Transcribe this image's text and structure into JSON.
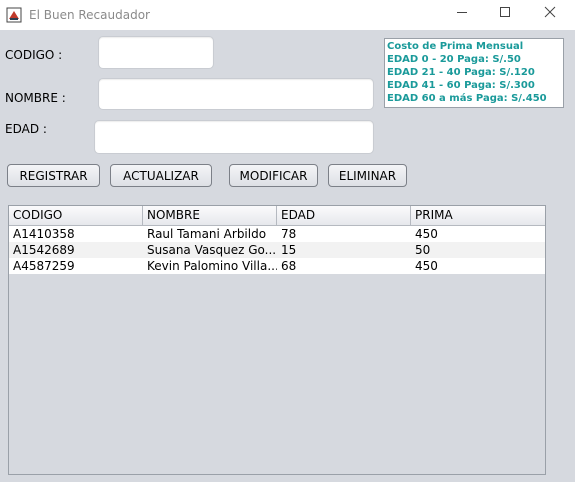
{
  "window": {
    "title": "El Buen Recaudador",
    "minimize_icon": "minimize-icon",
    "maximize_icon": "maximize-icon",
    "close_icon": "close-icon"
  },
  "form": {
    "codigo_label": "CODIGO :",
    "nombre_label": "NOMBRE :",
    "edad_label": "EDAD :",
    "codigo_value": "",
    "nombre_value": "",
    "edad_value": ""
  },
  "info_panel": {
    "lines": [
      "Costo de Prima Mensual",
      "EDAD 0 - 20 Paga: S/.50",
      "EDAD 21 - 40 Paga: S/.120",
      "EDAD 41 - 60 Paga: S/.300",
      "EDAD 60 a más Paga: S/.450"
    ],
    "text_color": "#1a9a9a"
  },
  "buttons": {
    "registrar": "REGISTRAR",
    "actualizar": "ACTUALIZAR",
    "modificar": "MODIFICAR",
    "eliminar": "ELIMINAR"
  },
  "table": {
    "headers": [
      "CODIGO",
      "NOMBRE",
      "EDAD",
      "PRIMA"
    ],
    "rows": [
      [
        "A1410358",
        "Raul Tamani Arbildo",
        "78",
        "450"
      ],
      [
        "A1542689",
        "Susana Vasquez Go...",
        "15",
        "50"
      ],
      [
        "A4587259",
        "Kevin Palomino Villa...",
        "68",
        "450"
      ]
    ]
  }
}
